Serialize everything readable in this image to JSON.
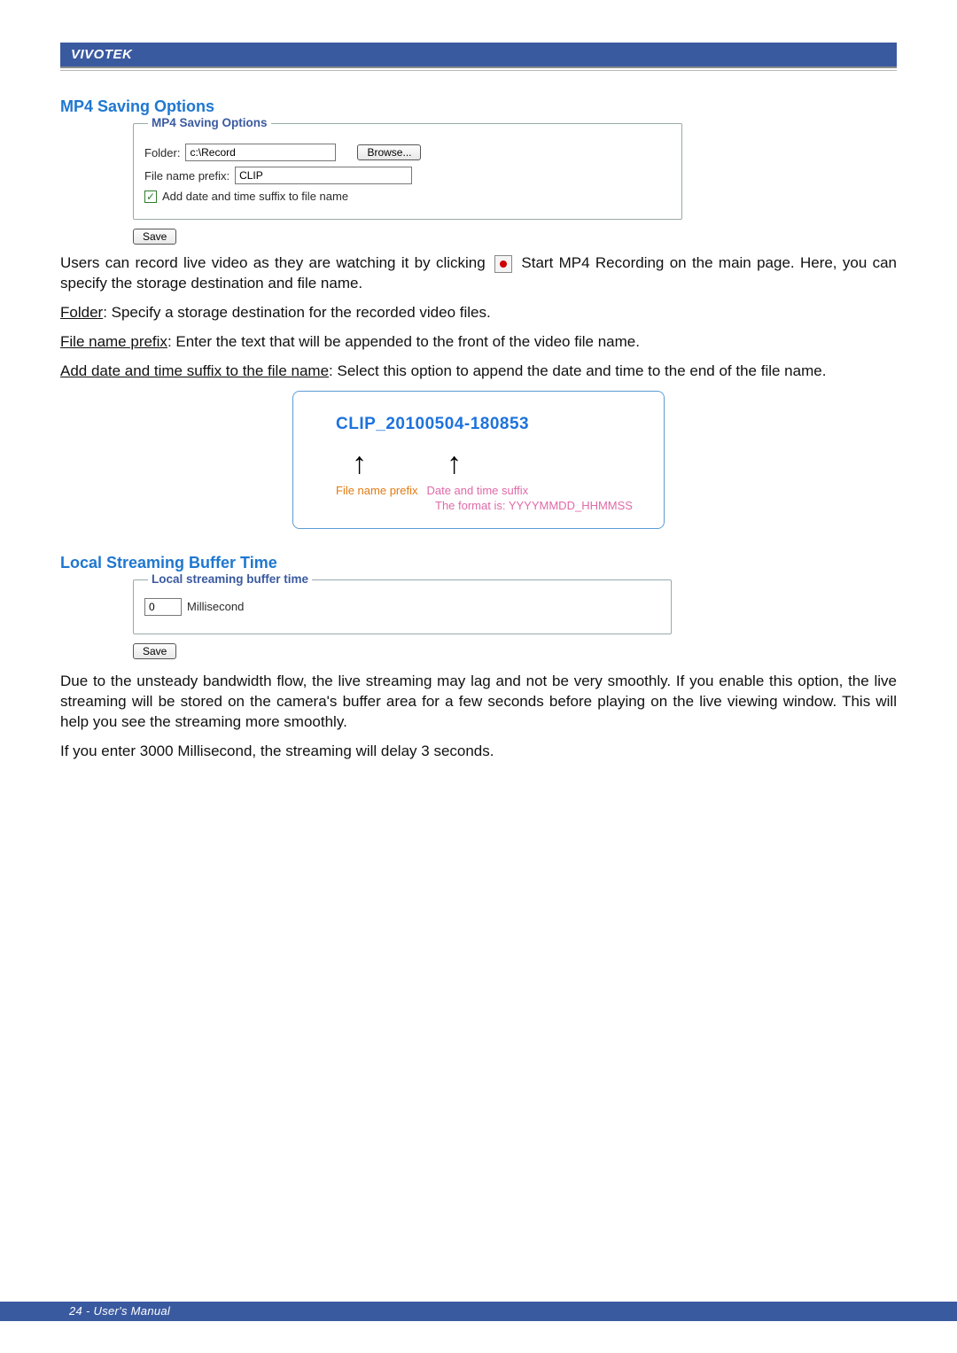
{
  "brand": "VIVOTEK",
  "sections": {
    "mp4": {
      "title": "MP4 Saving Options",
      "legend": "MP4 Saving Options",
      "folder_label": "Folder:",
      "folder_value": "c:\\Record",
      "browse_label": "Browse...",
      "prefix_label": "File name prefix:",
      "prefix_value": "CLIP",
      "suffix_label": "Add date and time suffix to file name",
      "save_label": "Save",
      "para1_a": "Users can record live video as they are watching it by clicking",
      "para1_b": "Start MP4 Recording on the main page. Here, you can specify the storage destination and file name.",
      "folder_desc_u": "Folder",
      "folder_desc_t": ": Specify a storage destination for the recorded video files.",
      "prefix_desc_u": "File name prefix",
      "prefix_desc_t": ": Enter the text that will be appended to the front of the video file name.",
      "suffix_desc_u": "Add date and time suffix to the file name",
      "suffix_desc_t": ": Select this option to append the date and time to the end of the file name.",
      "example_name": "CLIP_20100504-180853",
      "caption_prefix": "File name prefix",
      "caption_suffix": "Date and time suffix",
      "caption_format": "The format is: YYYYMMDD_HHMMSS"
    },
    "buffer": {
      "title": "Local Streaming Buffer Time",
      "legend": "Local streaming buffer time",
      "value": "0",
      "unit": "Millisecond",
      "save_label": "Save",
      "para_a": "Due to the unsteady bandwidth flow, the live streaming may lag and not be very smoothly. If you enable this option, the live streaming will be stored on the camera's buffer area for a few seconds before playing on the live viewing window. This will help you see the streaming more smoothly.",
      "para_b": "If you enter 3000 Millisecond, the streaming will delay 3 seconds."
    }
  },
  "footer": "24 - User's Manual"
}
